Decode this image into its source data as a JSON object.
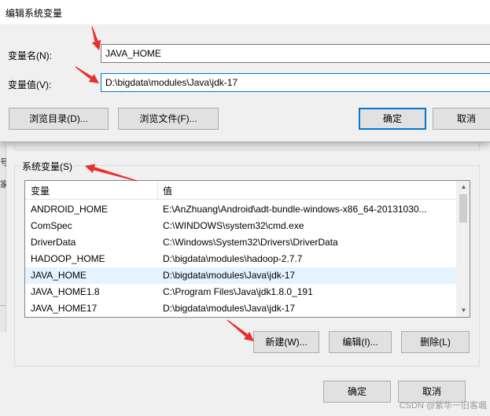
{
  "edit_dialog": {
    "title": "编辑系统变量",
    "name_label": "变量名(N):",
    "name_value": "JAVA_HOME",
    "value_label": "变量值(V):",
    "value_value": "D:\\bigdata\\modules\\Java\\jdk-17",
    "browse_dir_label": "浏览目录(D)...",
    "browse_file_label": "浏览文件(F)...",
    "ok_label": "确定",
    "cancel_label": "取消"
  },
  "env_dialog": {
    "left_fragments": [
      "号",
      "家"
    ],
    "system_vars_title": "系统变量(S)",
    "columns": [
      "变量",
      "值"
    ],
    "rows": [
      {
        "name": "ANDROID_HOME",
        "value": "E:\\AnZhuang\\Android\\adt-bundle-windows-x86_64-20131030..."
      },
      {
        "name": "ComSpec",
        "value": "C:\\WINDOWS\\system32\\cmd.exe"
      },
      {
        "name": "DriverData",
        "value": "C:\\Windows\\System32\\Drivers\\DriverData"
      },
      {
        "name": "HADOOP_HOME",
        "value": "D:\\bigdata\\modules\\hadoop-2.7.7"
      },
      {
        "name": "JAVA_HOME",
        "value": "D:\\bigdata\\modules\\Java\\jdk-17"
      },
      {
        "name": "JAVA_HOME1.8",
        "value": "C:\\Program Files\\Java\\jdk1.8.0_191"
      },
      {
        "name": "JAVA_HOME17",
        "value": "D:\\bigdata\\modules\\Java\\jdk-17"
      }
    ],
    "selected_row": 4,
    "new_label": "新建(W)...",
    "edit_label": "编辑(I)...",
    "delete_label": "删除(L)",
    "ok_label": "确定",
    "cancel_label": "取消"
  },
  "annotation_color": "#e8302a",
  "watermark": "CSDN @紫华一旧客颯"
}
